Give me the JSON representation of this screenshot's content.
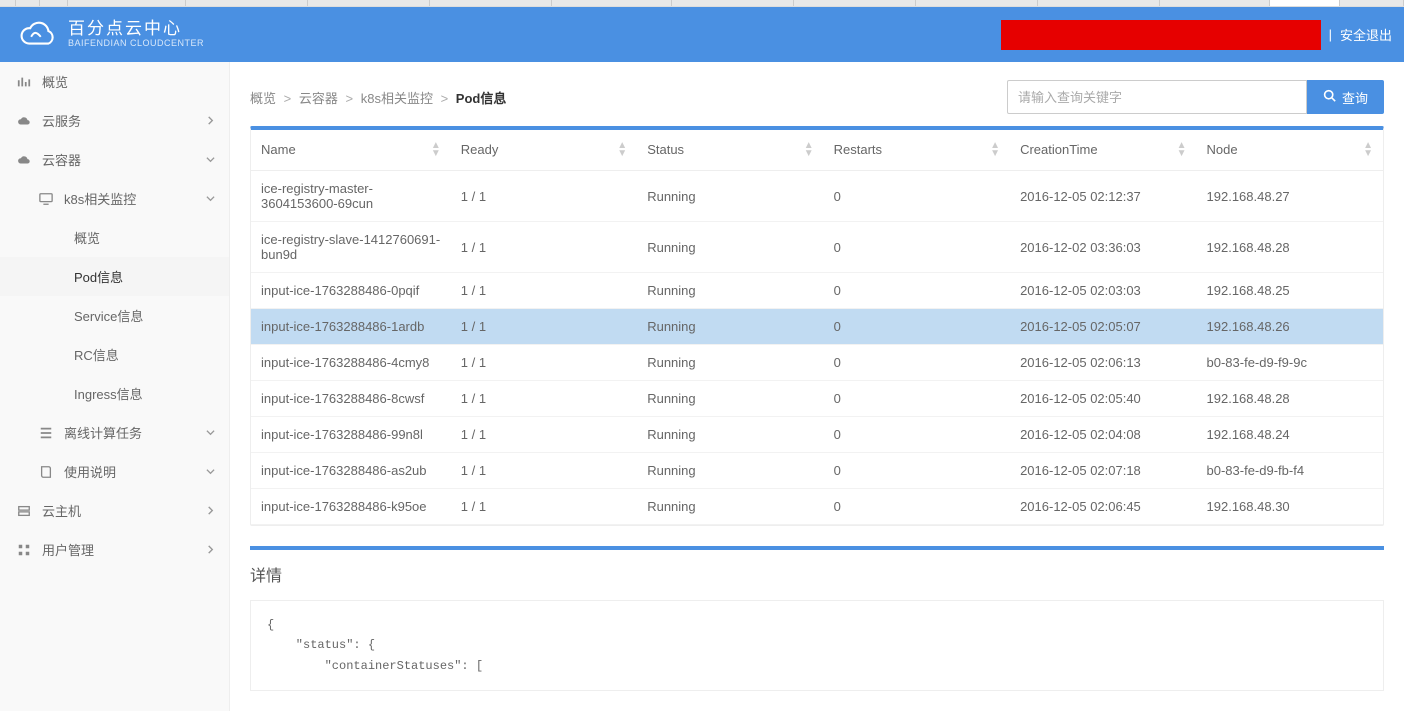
{
  "brand": {
    "cn": "百分点云中心",
    "en": "BAIFENDIAN CLOUDCENTER"
  },
  "header": {
    "divider": "|",
    "logout_label": "安全退出"
  },
  "sidebar": {
    "overview": "概览",
    "cloud_service": "云服务",
    "cloud_container": "云容器",
    "k8s_monitor": "k8s相关监控",
    "k8s_overview": "概览",
    "pod_info": "Pod信息",
    "service_info": "Service信息",
    "rc_info": "RC信息",
    "ingress_info": "Ingress信息",
    "offline_task": "离线计算任务",
    "usage": "使用说明",
    "cloud_host": "云主机",
    "user_mgmt": "用户管理"
  },
  "breadcrumb": {
    "l1": "概览",
    "l2": "云容器",
    "l3": "k8s相关监控",
    "current": "Pod信息",
    "sep": ">"
  },
  "search": {
    "placeholder": "请输入查询关键字",
    "button": "查询"
  },
  "table": {
    "columns": {
      "name": "Name",
      "ready": "Ready",
      "status": "Status",
      "restarts": "Restarts",
      "creation": "CreationTime",
      "node": "Node"
    },
    "rows": [
      {
        "name": "ice-registry-master-3604153600-69cun",
        "ready": "1 / 1",
        "status": "Running",
        "restarts": "0",
        "creation": "2016-12-05 02:12:37",
        "node": "192.168.48.27",
        "selected": false
      },
      {
        "name": "ice-registry-slave-1412760691-bun9d",
        "ready": "1 / 1",
        "status": "Running",
        "restarts": "0",
        "creation": "2016-12-02 03:36:03",
        "node": "192.168.48.28",
        "selected": false
      },
      {
        "name": "input-ice-1763288486-0pqif",
        "ready": "1 / 1",
        "status": "Running",
        "restarts": "0",
        "creation": "2016-12-05 02:03:03",
        "node": "192.168.48.25",
        "selected": false
      },
      {
        "name": "input-ice-1763288486-1ardb",
        "ready": "1 / 1",
        "status": "Running",
        "restarts": "0",
        "creation": "2016-12-05 02:05:07",
        "node": "192.168.48.26",
        "selected": true
      },
      {
        "name": "input-ice-1763288486-4cmy8",
        "ready": "1 / 1",
        "status": "Running",
        "restarts": "0",
        "creation": "2016-12-05 02:06:13",
        "node": "b0-83-fe-d9-f9-9c",
        "selected": false
      },
      {
        "name": "input-ice-1763288486-8cwsf",
        "ready": "1 / 1",
        "status": "Running",
        "restarts": "0",
        "creation": "2016-12-05 02:05:40",
        "node": "192.168.48.28",
        "selected": false
      },
      {
        "name": "input-ice-1763288486-99n8l",
        "ready": "1 / 1",
        "status": "Running",
        "restarts": "0",
        "creation": "2016-12-05 02:04:08",
        "node": "192.168.48.24",
        "selected": false
      },
      {
        "name": "input-ice-1763288486-as2ub",
        "ready": "1 / 1",
        "status": "Running",
        "restarts": "0",
        "creation": "2016-12-05 02:07:18",
        "node": "b0-83-fe-d9-fb-f4",
        "selected": false
      },
      {
        "name": "input-ice-1763288486-k95oe",
        "ready": "1 / 1",
        "status": "Running",
        "restarts": "0",
        "creation": "2016-12-05 02:06:45",
        "node": "192.168.48.30",
        "selected": false
      }
    ]
  },
  "detail": {
    "title": "详情",
    "body": "{\n    \"status\": {\n        \"containerStatuses\": ["
  }
}
